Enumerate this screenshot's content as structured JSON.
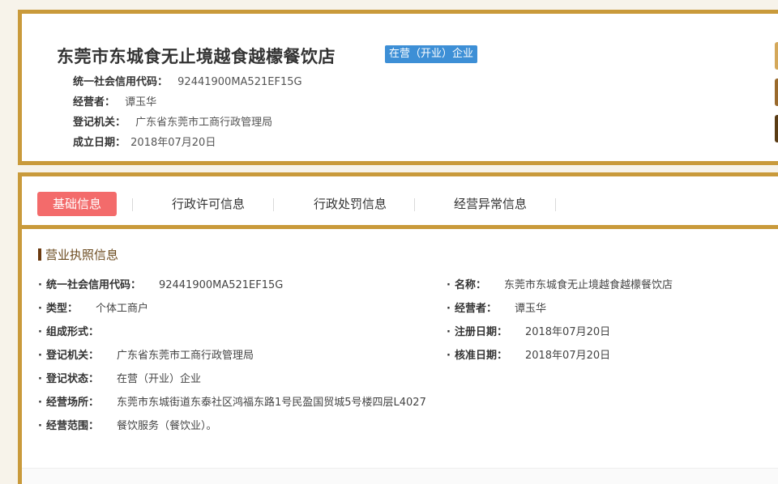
{
  "header": {
    "company_name": "东莞市东城食无止境越食越檬餐饮店",
    "status_badge": "在营（开业）企业",
    "rows": [
      {
        "label": "统一社会信用代码：",
        "value": "92441900MA521EF15G"
      },
      {
        "label": "经营者：",
        "value": "谭玉华"
      },
      {
        "label": "登记机关：",
        "value": "广东省东莞市工商行政管理局"
      },
      {
        "label": "成立日期：",
        "value": "2018年07月20日"
      }
    ]
  },
  "tabs": [
    {
      "label": "基础信息",
      "active": true
    },
    {
      "label": "行政许可信息",
      "active": false
    },
    {
      "label": "行政处罚信息",
      "active": false
    },
    {
      "label": "经营异常信息",
      "active": false
    }
  ],
  "section": {
    "title": "营业执照信息",
    "left_fields": [
      {
        "label": "统一社会信用代码：",
        "value": "92441900MA521EF15G"
      },
      {
        "label": "类型：",
        "value": "个体工商户"
      },
      {
        "label": "组成形式：",
        "value": ""
      },
      {
        "label": "登记机关：",
        "value": "广东省东莞市工商行政管理局"
      },
      {
        "label": "登记状态：",
        "value": "在营（开业）企业"
      },
      {
        "label": "经营场所：",
        "value": "东莞市东城街道东泰社区鸿福东路1号民盈国贸城5号楼四层L4027"
      },
      {
        "label": "经营范围：",
        "value": "餐饮服务（餐饮业）。"
      }
    ],
    "right_fields": [
      {
        "label": "名称：",
        "value": "东莞市东城食无止境越食越檬餐饮店"
      },
      {
        "label": "经营者：",
        "value": "谭玉华"
      },
      {
        "label": "注册日期：",
        "value": "2018年07月20日"
      },
      {
        "label": "核准日期：",
        "value": "2018年07月20日"
      }
    ]
  },
  "colors": {
    "border_gold": "#c99a3b",
    "badge_blue": "#3d8fd6",
    "active_tab": "#f36b6b",
    "section_brown": "#6b4a1e",
    "side_tab_1": "#d4a85a",
    "side_tab_2": "#9a6a2c",
    "side_tab_3": "#5a3c14"
  }
}
